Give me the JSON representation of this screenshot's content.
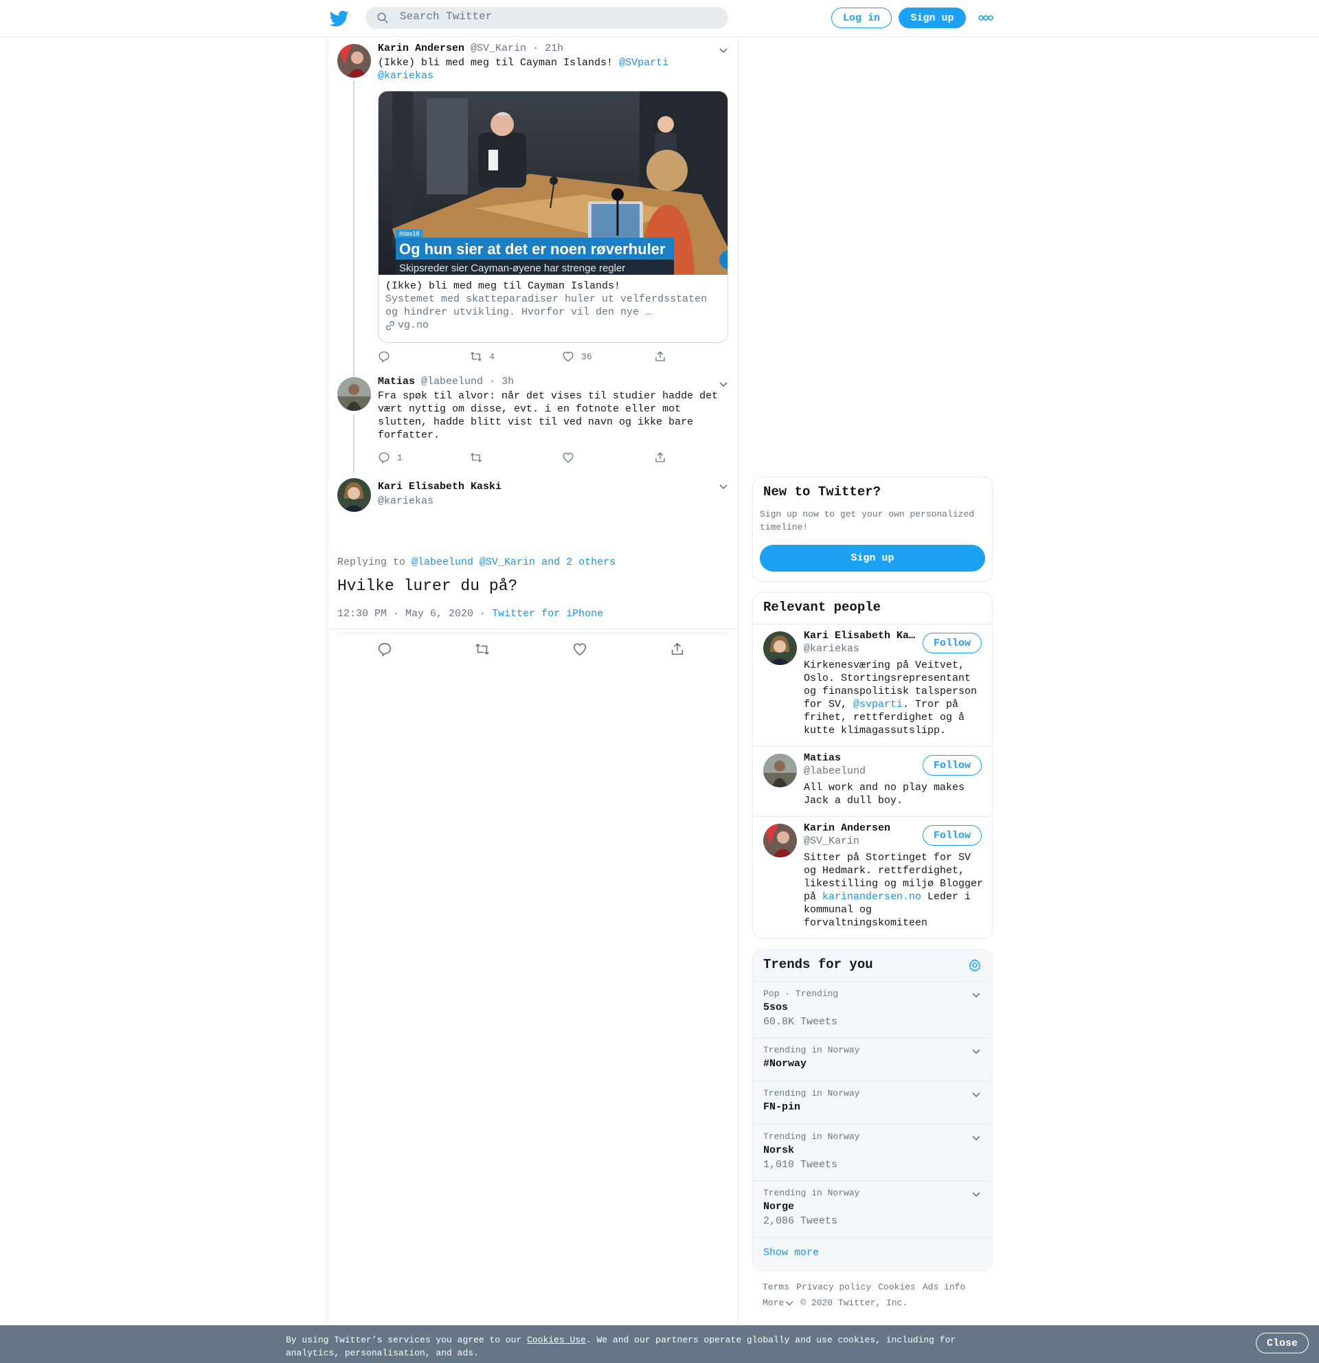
{
  "header": {
    "search_placeholder": "Search Twitter",
    "login_label": "Log in",
    "signup_label": "Sign up"
  },
  "thread": [
    {
      "name": "Karin Andersen",
      "handle": "@SV_Karin",
      "time": "21h",
      "text": "(Ikke) bli med meg til Cayman Islands! ",
      "mentions": [
        "@SVparti",
        "@kariekas"
      ],
      "card": {
        "image_hashtag": "#dax18",
        "image_headline": "Og hun sier at det er noen røverhuler",
        "image_subline": "Skipsreder sier Cayman-øyene har strenge regler",
        "title": "(Ikke) bli med meg til Cayman Islands!",
        "description": "Systemet med skatteparadiser huler ut velferdsstaten og hindrer utvikling. Hvorfor vil den nye …",
        "domain": "vg.no"
      },
      "counts": {
        "reply": "",
        "retweet": "4",
        "like": "36"
      }
    },
    {
      "name": "Matias",
      "handle": "@labeelund",
      "time": "3h",
      "text": "Fra spøk til alvor: når det vises til studier hadde det vært nyttig om disse, evt. i en fotnote eller mot slutten, hadde blitt vist til ved navn og ikke bare forfatter.",
      "counts": {
        "reply": "1",
        "retweet": "",
        "like": ""
      }
    }
  ],
  "focused": {
    "name": "Kari Elisabeth Kaski",
    "handle": "@kariekas",
    "replying_prefix": "Replying to ",
    "replying_to": "@labeelund @SV_Karin and 2 others",
    "text": "Hvilke lurer du på?",
    "timestamp": "12:30 PM · May 6, 2020",
    "source": "Twitter for iPhone"
  },
  "sidebar": {
    "new_title": "New to Twitter?",
    "new_subtitle": "Sign up now to get your own personalized timeline!",
    "new_signup": "Sign up",
    "relevant_title": "Relevant people",
    "people": [
      {
        "name": "Kari Elisabeth Kaski",
        "handle": "@kariekas",
        "bio_before": "Kirkenesværing på Veitvet, Oslo. Stortingsrepresentant og finanspolitisk talsperson for SV, ",
        "bio_link": "@svparti",
        "bio_after": ". Tror på frihet, rettferdighet og å kutte klimagassutslipp.",
        "follow": "Follow"
      },
      {
        "name": "Matias",
        "handle": "@labeelund",
        "bio_before": "All work and no play makes Jack a dull boy.",
        "bio_link": "",
        "bio_after": "",
        "follow": "Follow"
      },
      {
        "name": "Karin Andersen",
        "handle": "@SV_Karin",
        "bio_before": "Sitter på Stortinget for SV og Hedmark. rettferdighet, likestilling og miljø Blogger på ",
        "bio_link": "karinandersen.no",
        "bio_after": " Leder i kommunal og forvaltningskomiteen",
        "follow": "Follow"
      }
    ],
    "trends_title": "Trends for you",
    "trends": [
      {
        "category": "Pop · Trending",
        "name": "5sos",
        "count": "60.8K Tweets"
      },
      {
        "category": "Trending in Norway",
        "name": "#Norway",
        "count": ""
      },
      {
        "category": "Trending in Norway",
        "name": "FN-pin",
        "count": ""
      },
      {
        "category": "Trending in Norway",
        "name": "Norsk",
        "count": "1,010 Tweets"
      },
      {
        "category": "Trending in Norway",
        "name": "Norge",
        "count": "2,086 Tweets"
      }
    ],
    "show_more": "Show more",
    "footer": {
      "links": [
        "Terms",
        "Privacy policy",
        "Cookies",
        "Ads info"
      ],
      "more": "More",
      "copyright": "© 2020 Twitter, Inc."
    }
  },
  "cookie": {
    "text_before": "By using Twitter’s services you agree to our ",
    "link": "Cookies Use",
    "text_after": ". We and our partners operate globally and use cookies, including for analytics, personalisation, and ads.",
    "close": "Close"
  },
  "colors": {
    "brand": "#1da1f2",
    "link": "#1b95e0",
    "muted": "#657786",
    "cookie_bar": "#657786"
  }
}
